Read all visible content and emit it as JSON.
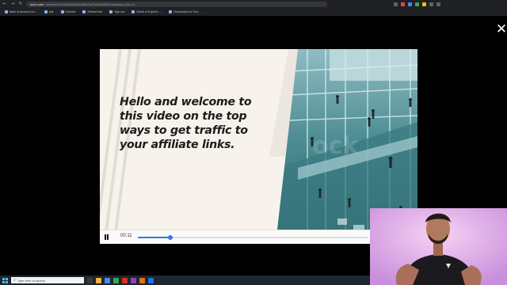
{
  "browser": {
    "nav_back": "←",
    "nav_forward": "→",
    "nav_reload": "↻",
    "url_host": "loom.com",
    "url_path": "/share/b4f7e2a0c8d94e1b9f3c6a72d05e18b3?autoplay=1&t=11",
    "bookmarks": [
      "Bank of America Ho...",
      "ads",
      "Funnels",
      "StreamYard",
      "Sign out",
      "Board of Experts -...",
      "Dashboard for Tool..."
    ]
  },
  "overlay": {
    "close_symbol": "✕"
  },
  "video": {
    "headline_lines": [
      "Hello and welcome to",
      "this video on the top",
      "ways to get traffic to",
      "your affiliate links."
    ],
    "current_time": "00:11",
    "progress": 0.14
  },
  "taskbar": {
    "search_placeholder": "Type here to search",
    "search_icon": "search-icon"
  },
  "colors": {
    "accent": "#2e7be0",
    "headline": "#1c1c1c",
    "slide_bg": "#f7f3ec",
    "webcam_bg": "#e3a9e6"
  }
}
